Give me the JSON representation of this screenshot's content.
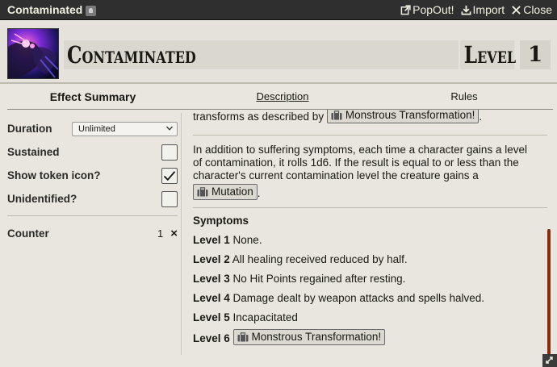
{
  "window": {
    "title": "Contaminated",
    "controls": {
      "popout": "PopOut!",
      "import": "Import",
      "close": "Close"
    }
  },
  "header": {
    "name": "Contaminated",
    "level_label": "Level",
    "level_value": "1"
  },
  "tabs": [
    {
      "label": "Effect Summary"
    },
    {
      "label": "Description"
    },
    {
      "label": "Rules"
    }
  ],
  "summary": {
    "duration_label": "Duration",
    "duration_value": "Unlimited",
    "sustained_label": "Sustained",
    "sustained_checked": false,
    "show_token_label": "Show token icon?",
    "show_token_checked": true,
    "unidentified_label": "Unidentified?",
    "unidentified_checked": false,
    "counter_label": "Counter",
    "counter_value": "1",
    "counter_remove": "×"
  },
  "description": {
    "cut_text": "transforms as described by",
    "cut_link": "Monstrous Transformation!",
    "para_line1": "In addition to suffering symptoms, each time a character gains a level",
    "para_line2": "of contamination, it rolls 1d6. If the result is equal to or less than the",
    "para_line3": "character's current contamination level the creature gains a",
    "para_link": "Mutation",
    "symptoms_heading": "Symptoms",
    "levels": [
      {
        "label": "Level 1",
        "text": "None."
      },
      {
        "label": "Level 2",
        "text": "All healing received reduced by half."
      },
      {
        "label": "Level 3",
        "text": "No Hit Points regained after resting."
      },
      {
        "label": "Level 4",
        "text": "Damage dealt by weapon attacks and spells halved."
      },
      {
        "label": "Level 5",
        "text": "Incapacitated"
      },
      {
        "label": "Level 6",
        "link": "Monstrous Transformation!"
      }
    ]
  },
  "icons": {
    "badge": "lock-badge-icon",
    "popout": "external-link-icon",
    "import": "download-icon",
    "close": "close-icon",
    "content_link": "suitcase-icon"
  },
  "colors": {
    "titlebar": "#2f2f2f",
    "scrollbar": "#8a2b0d",
    "background": "#e8e6df"
  }
}
